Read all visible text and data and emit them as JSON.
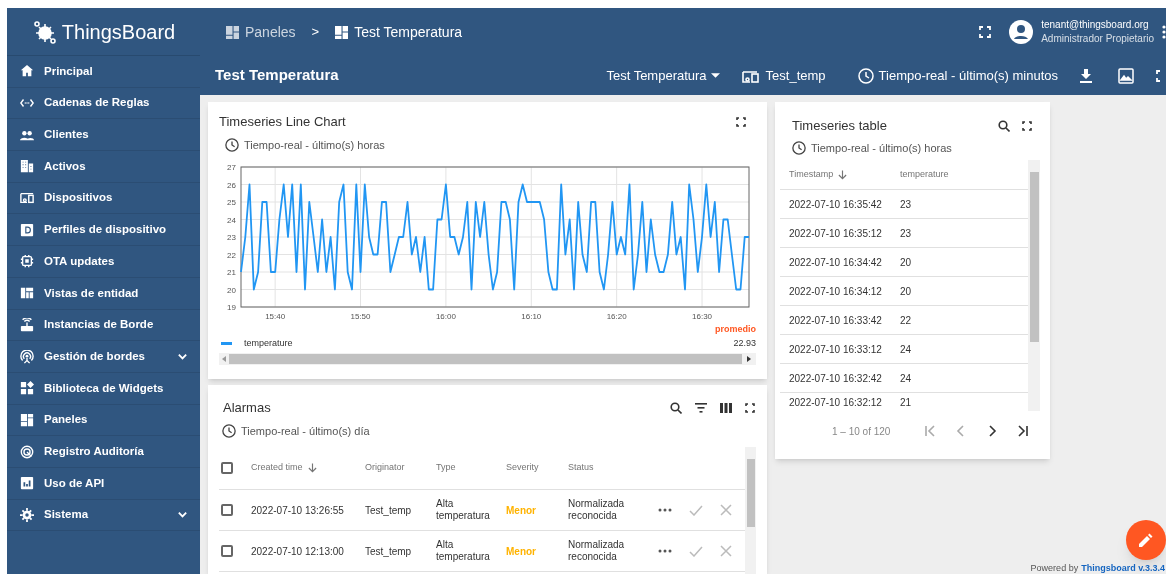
{
  "header": {
    "logo_text": "ThingsBoard",
    "breadcrumbs": [
      {
        "label": "Paneles",
        "current": false
      },
      {
        "label": "Test Temperatura",
        "current": true
      }
    ],
    "separator": ">",
    "user": {
      "email": "tenant@thingsboard.org",
      "role": "Administrador Propietario"
    }
  },
  "sidebar": {
    "items": [
      {
        "label": "Principal",
        "kind": "link"
      },
      {
        "label": "Cadenas de Reglas",
        "kind": "link"
      },
      {
        "label": "Clientes",
        "kind": "link"
      },
      {
        "label": "Activos",
        "kind": "link"
      },
      {
        "label": "Dispositivos",
        "kind": "link"
      },
      {
        "label": "Perfiles de dispositivo",
        "kind": "link"
      },
      {
        "label": "OTA updates",
        "kind": "link"
      },
      {
        "label": "Vistas de entidad",
        "kind": "link"
      },
      {
        "label": "Instancias de Borde",
        "kind": "link"
      },
      {
        "label": "Gestión de bordes",
        "kind": "group"
      },
      {
        "label": "Biblioteca de Widgets",
        "kind": "link"
      },
      {
        "label": "Paneles",
        "kind": "link"
      },
      {
        "label": "Registro Auditoría",
        "kind": "link"
      },
      {
        "label": "Uso de API",
        "kind": "link"
      },
      {
        "label": "Sistema",
        "kind": "group"
      }
    ]
  },
  "toolbar": {
    "title": "Test Temperatura",
    "dashboard_state": "Test Temperatura",
    "entity": "Test_temp",
    "timewindow": "Tiempo-real - último(s) minutos"
  },
  "chart_widget": {
    "title": "Timeseries Line Chart",
    "timewindow": "Tiempo-real - último(s) horas",
    "chart_data": {
      "type": "line",
      "grid": true,
      "xlim": [
        936,
        995.5
      ],
      "ylim": [
        19,
        27
      ],
      "yticks": [
        19,
        20,
        21,
        22,
        23,
        24,
        25,
        26,
        27
      ],
      "xticks": [
        {
          "value": 940,
          "label": "15:40"
        },
        {
          "value": 950,
          "label": "15:50"
        },
        {
          "value": 960,
          "label": "16:00"
        },
        {
          "value": 970,
          "label": "16:10"
        },
        {
          "value": 980,
          "label": "16:20"
        },
        {
          "value": 990,
          "label": "16:30"
        }
      ],
      "x": [
        936,
        936.5,
        937,
        937.5,
        938,
        938.5,
        939,
        939.5,
        940,
        940.5,
        941,
        941.5,
        942,
        942.5,
        943,
        943.5,
        944,
        944.5,
        945,
        945.5,
        946,
        946.5,
        947,
        947.5,
        948,
        948.5,
        949,
        949.5,
        950,
        950.5,
        951,
        951.5,
        952,
        952.5,
        953,
        953.5,
        954,
        954.5,
        955,
        955.5,
        956,
        956.5,
        957,
        957.5,
        958,
        958.5,
        959,
        959.5,
        960,
        960.5,
        961,
        961.5,
        962,
        962.5,
        963,
        963.5,
        964,
        964.5,
        965,
        965.5,
        966,
        966.5,
        967,
        967.5,
        968,
        968.5,
        969,
        969.5,
        970,
        970.5,
        971,
        971.5,
        972,
        972.5,
        973,
        973.5,
        974,
        974.5,
        975,
        975.5,
        976,
        976.5,
        977,
        977.5,
        978,
        978.5,
        979,
        979.5,
        980,
        980.5,
        981,
        981.5,
        982,
        982.5,
        983,
        983.5,
        984,
        984.5,
        985,
        985.5,
        986,
        986.5,
        987,
        987.5,
        988,
        988.5,
        989,
        989.5,
        990,
        990.5,
        991,
        991.5,
        992,
        992.5,
        993,
        993.5,
        994,
        994.5,
        995,
        995.5
      ],
      "series": [
        {
          "name": "temperature",
          "color": "#2196f3",
          "values": [
            21,
            23,
            26,
            20,
            21,
            25,
            25,
            21,
            21,
            24,
            26,
            23,
            26,
            21,
            26,
            20,
            25,
            23,
            21,
            24,
            21,
            23,
            20,
            25,
            26,
            21,
            20,
            26,
            21,
            26,
            23,
            22,
            22,
            25,
            25,
            21,
            22,
            23,
            23,
            25,
            22,
            23,
            21,
            23,
            20,
            20,
            24,
            24,
            26,
            23,
            23,
            22,
            23,
            25,
            20,
            25,
            23,
            25,
            22,
            20,
            21,
            25,
            25,
            24,
            20,
            25,
            26,
            25,
            25,
            25,
            25,
            24,
            21,
            20,
            20,
            26,
            22,
            24,
            20,
            25,
            22,
            21,
            25,
            25,
            21,
            20,
            22,
            25,
            22,
            23,
            22,
            26,
            20,
            22,
            25,
            21,
            24,
            22,
            21,
            21,
            22,
            25,
            22,
            23,
            20,
            26,
            24,
            21,
            23,
            26,
            23,
            25,
            21,
            24,
            24,
            22,
            20,
            20,
            23,
            23
          ]
        }
      ]
    },
    "legend": {
      "header": "promedio",
      "values": [
        "22.93"
      ]
    }
  },
  "alarms_widget": {
    "title": "Alarmas",
    "timewindow": "Tiempo-real - último(s) día",
    "all_checked": false,
    "columns": [
      {
        "label": "Created time",
        "sorted": true
      },
      {
        "label": "Originator",
        "sorted": false
      },
      {
        "label": "Type",
        "sorted": false
      },
      {
        "label": "Severity",
        "sorted": false
      },
      {
        "label": "Status",
        "sorted": false
      }
    ],
    "rows": [
      {
        "checked": false,
        "created": "2022-07-10 13:26:55",
        "originator": "Test_temp",
        "type": "Alta temperatura",
        "severity": "Menor",
        "color": "#ffb300",
        "status": "Normalizada reconocida"
      },
      {
        "checked": false,
        "created": "2022-07-10 12:13:00",
        "originator": "Test_temp",
        "type": "Alta temperatura",
        "severity": "Menor",
        "color": "#ffb300",
        "status": "Normalizada reconocida"
      }
    ]
  },
  "timeseries_table": {
    "title": "Timeseries table",
    "timewindow": "Tiempo-real - último(s) horas",
    "columns": [
      {
        "label": "Timestamp",
        "sorted": true
      },
      {
        "label": "temperature",
        "sorted": false
      }
    ],
    "rows": [
      [
        "2022-07-10 16:35:42",
        "23"
      ],
      [
        "2022-07-10 16:35:12",
        "23"
      ],
      [
        "2022-07-10 16:34:42",
        "20"
      ],
      [
        "2022-07-10 16:34:12",
        "20"
      ],
      [
        "2022-07-10 16:33:42",
        "22"
      ],
      [
        "2022-07-10 16:33:12",
        "24"
      ],
      [
        "2022-07-10 16:32:42",
        "24"
      ],
      [
        "2022-07-10 16:32:12",
        "21"
      ]
    ],
    "pagination": {
      "range": "1 – 10 of 120",
      "buttons": [
        {
          "kind": "first",
          "disabled": true
        },
        {
          "kind": "prev",
          "disabled": true
        },
        {
          "kind": "next",
          "disabled": false
        },
        {
          "kind": "last",
          "disabled": false
        }
      ]
    }
  },
  "footer": {
    "text": "Powered by",
    "link": "Thingsboard v.3.3.4"
  }
}
